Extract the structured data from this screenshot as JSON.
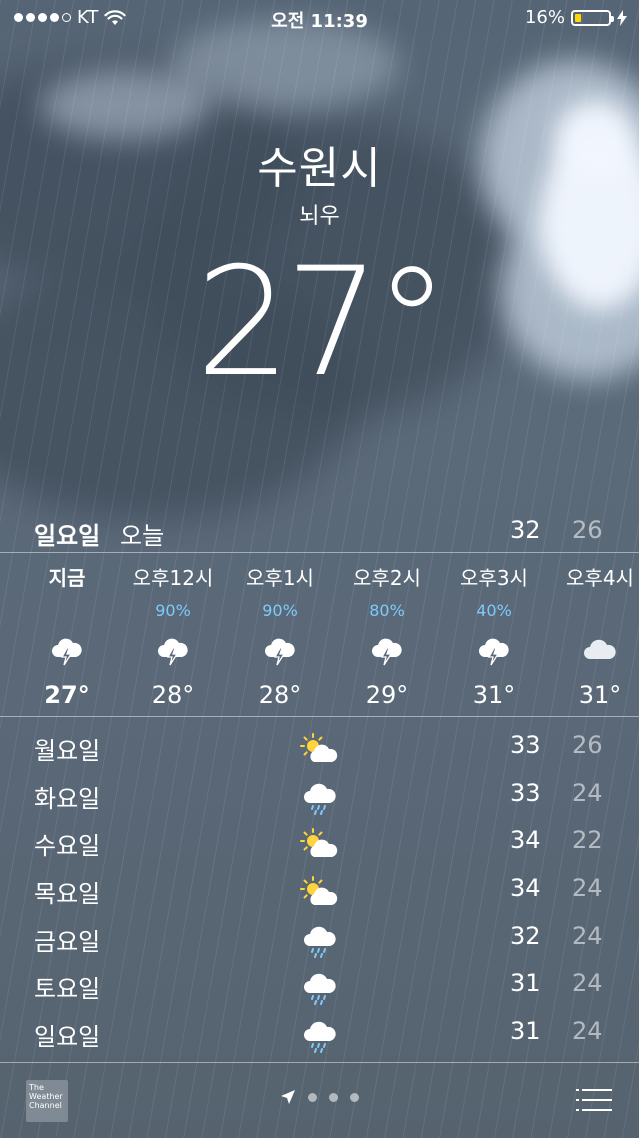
{
  "status": {
    "carrier": "KT",
    "time": "오전 11:39",
    "battery_percent": "16%",
    "battery_level": 0.16,
    "signal_bars": 4
  },
  "location": {
    "city": "수원시",
    "condition": "뇌우",
    "temperature": "27°"
  },
  "today": {
    "day": "일요일",
    "label": "오늘",
    "high": "32",
    "low": "26"
  },
  "hourly": [
    {
      "time": "지금",
      "precip": "",
      "icon": "thunderstorm-icon",
      "temp": "27°"
    },
    {
      "time": "오후12시",
      "precip": "90%",
      "icon": "thunderstorm-icon",
      "temp": "28°"
    },
    {
      "time": "오후1시",
      "precip": "90%",
      "icon": "thunderstorm-icon",
      "temp": "28°"
    },
    {
      "time": "오후2시",
      "precip": "80%",
      "icon": "thunderstorm-icon",
      "temp": "29°"
    },
    {
      "time": "오후3시",
      "precip": "40%",
      "icon": "thunderstorm-icon",
      "temp": "31°"
    },
    {
      "time": "오후4시",
      "precip": "",
      "icon": "cloudy-icon",
      "temp": "31°"
    }
  ],
  "daily": [
    {
      "day": "월요일",
      "icon": "partly-sunny-icon",
      "high": "33",
      "low": "26"
    },
    {
      "day": "화요일",
      "icon": "rain-icon",
      "high": "33",
      "low": "24"
    },
    {
      "day": "수요일",
      "icon": "partly-sunny-icon",
      "high": "34",
      "low": "22"
    },
    {
      "day": "목요일",
      "icon": "partly-sunny-icon",
      "high": "34",
      "low": "24"
    },
    {
      "day": "금요일",
      "icon": "rain-icon",
      "high": "32",
      "low": "24"
    },
    {
      "day": "토요일",
      "icon": "rain-icon",
      "high": "31",
      "low": "24"
    },
    {
      "day": "일요일",
      "icon": "rain-icon",
      "high": "31",
      "low": "24"
    }
  ],
  "footer": {
    "logo_text": "The Weather Channel",
    "page_count": 3
  },
  "colors": {
    "precip_blue": "#7ecaf9",
    "battery_yellow": "#ffd60a"
  }
}
